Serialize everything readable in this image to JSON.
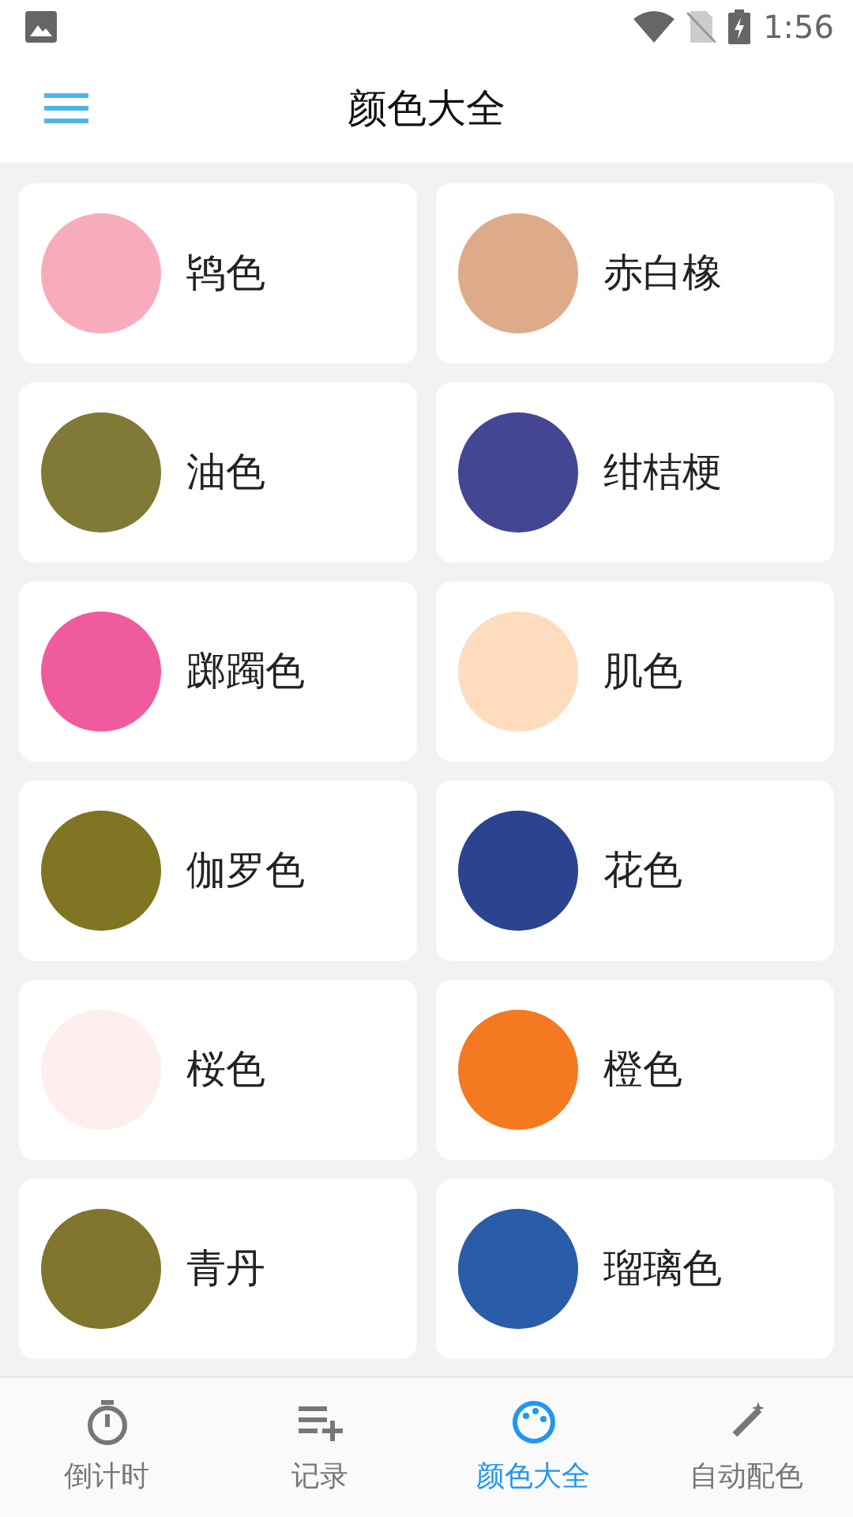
{
  "status_bar": {
    "time": "1:56"
  },
  "app_bar": {
    "title": "颜色大全"
  },
  "colors": [
    {
      "name": "鸨色",
      "color": "#f7acbc"
    },
    {
      "name": "赤白橡",
      "color": "#deab8a"
    },
    {
      "name": "油色",
      "color": "#817936"
    },
    {
      "name": "绀桔梗",
      "color": "#444693"
    },
    {
      "name": "踯躅色",
      "color": "#ef5b9c"
    },
    {
      "name": "肌色",
      "color": "#fedcbd"
    },
    {
      "name": "伽罗色",
      "color": "#7f7522"
    },
    {
      "name": "花色",
      "color": "#2b4490"
    },
    {
      "name": "桜色",
      "color": "#feeeed"
    },
    {
      "name": "橙色",
      "color": "#f47920"
    },
    {
      "name": "青丹",
      "color": "#80752c"
    },
    {
      "name": "瑠璃色",
      "color": "#2a5caa"
    }
  ],
  "bottom_nav": [
    {
      "label": "倒计时",
      "kind": "timer",
      "selected": false
    },
    {
      "label": "记录",
      "kind": "record",
      "selected": false
    },
    {
      "label": "颜色大全",
      "kind": "palette",
      "selected": true
    },
    {
      "label": "自动配色",
      "kind": "auto",
      "selected": false
    }
  ]
}
